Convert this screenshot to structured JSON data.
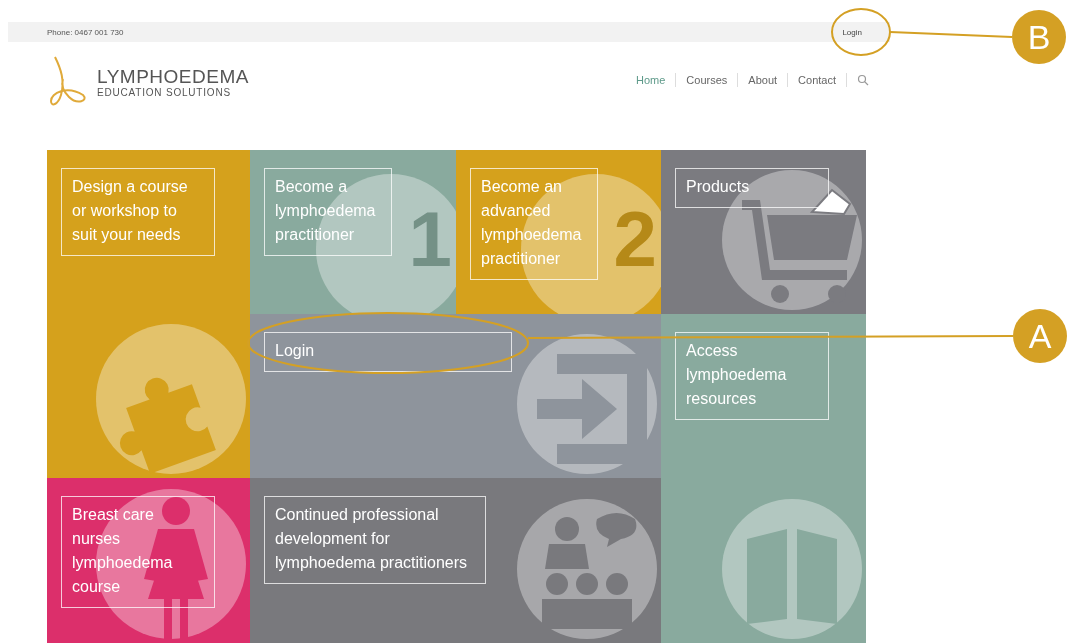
{
  "top_bar": {
    "phone": "Phone: 0467 001 730",
    "login": "Login"
  },
  "logo": {
    "title": "LYMPHOEDEMA",
    "subtitle": "EDUCATION SOLUTIONS"
  },
  "nav": [
    {
      "label": "Home",
      "selected": true
    },
    {
      "label": "Courses",
      "selected": false
    },
    {
      "label": "About",
      "selected": false
    },
    {
      "label": "Contact",
      "selected": false
    }
  ],
  "tiles": [
    {
      "kind": "puzzle",
      "label": "Design a course or workshop to suit your needs",
      "color": "#d5a11c"
    },
    {
      "kind": "numeral",
      "numeral": "1",
      "label": "Become a lymphoedema practitioner",
      "color": "#89aa9e"
    },
    {
      "kind": "numeral",
      "numeral": "2",
      "label": "Become an advanced lymphoedema practitioner",
      "color": "#d5a11c"
    },
    {
      "kind": "cart",
      "label": "Products",
      "color": "#7b7b80"
    },
    {
      "kind": "login",
      "label": "Login",
      "color": "#8e949c"
    },
    {
      "kind": "book",
      "label": "Access lymphoedema resources",
      "color": "#89aa9e"
    },
    {
      "kind": "woman",
      "label": "Breast care nurses lymphoedema course",
      "color": "#dc2f6b"
    },
    {
      "kind": "audience",
      "label": "Continued professional development for lymphoedema practitioners",
      "color": "#79797d"
    }
  ],
  "callouts": [
    {
      "letter": "B"
    },
    {
      "letter": "A"
    }
  ]
}
